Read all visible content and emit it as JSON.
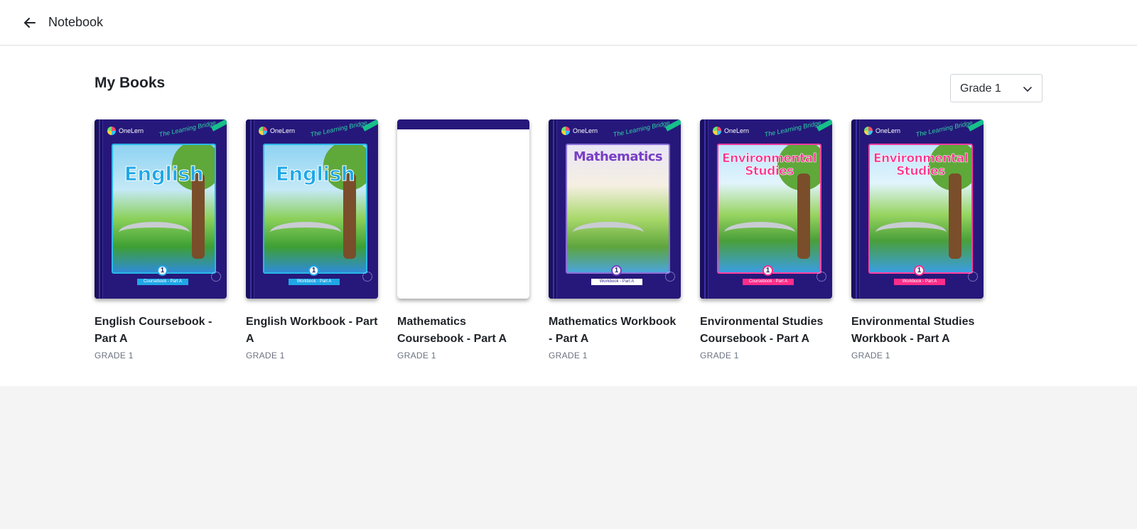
{
  "header": {
    "title": "Notebook",
    "back_icon": "arrow-left-icon"
  },
  "main": {
    "section_title": "My Books",
    "grade_filter": {
      "selected": "Grade 1",
      "icon": "chevron-down-icon"
    }
  },
  "books": [
    {
      "title": "English Coursebook - Part A",
      "grade": "GRADE 1",
      "cover": {
        "subject": "English",
        "number": "1",
        "strip": "Coursebook - Part A",
        "brand": "OneLern",
        "tagline": "The Learning Bridge"
      }
    },
    {
      "title": "English Workbook - Part A",
      "grade": "GRADE 1",
      "cover": {
        "subject": "English",
        "number": "1",
        "strip": "Workbook - Part A",
        "brand": "OneLern",
        "tagline": "The Learning Bridge"
      }
    },
    {
      "title": "Mathematics Coursebook - Part A",
      "grade": "GRADE 1",
      "cover": {
        "blank": true
      }
    },
    {
      "title": "Mathematics Workbook - Part A",
      "grade": "GRADE 1",
      "cover": {
        "subject": "Mathematics",
        "number": "1",
        "strip": "Workbook - Part A",
        "brand": "OneLern",
        "tagline": "The Learning Bridge"
      }
    },
    {
      "title": "Environmental Studies Coursebook - Part A",
      "grade": "GRADE 1",
      "cover": {
        "subject": "Environmental Studies",
        "number": "1",
        "strip": "Coursebook - Part A",
        "brand": "OneLern",
        "tagline": "The Learning Bridge"
      }
    },
    {
      "title": "Environmental Studies Workbook - Part A",
      "grade": "GRADE 1",
      "cover": {
        "subject": "Environmental Studies",
        "number": "1",
        "strip": "Workbook - Part A",
        "brand": "OneLern",
        "tagline": "The Learning Bridge"
      }
    }
  ],
  "colors": {
    "cover_bg": "#26187a",
    "accent_blue": "#1fa7e6",
    "accent_pink": "#ff2d8a",
    "accent_violet": "#7a3fc6",
    "page_bg": "#f4f4f4"
  }
}
